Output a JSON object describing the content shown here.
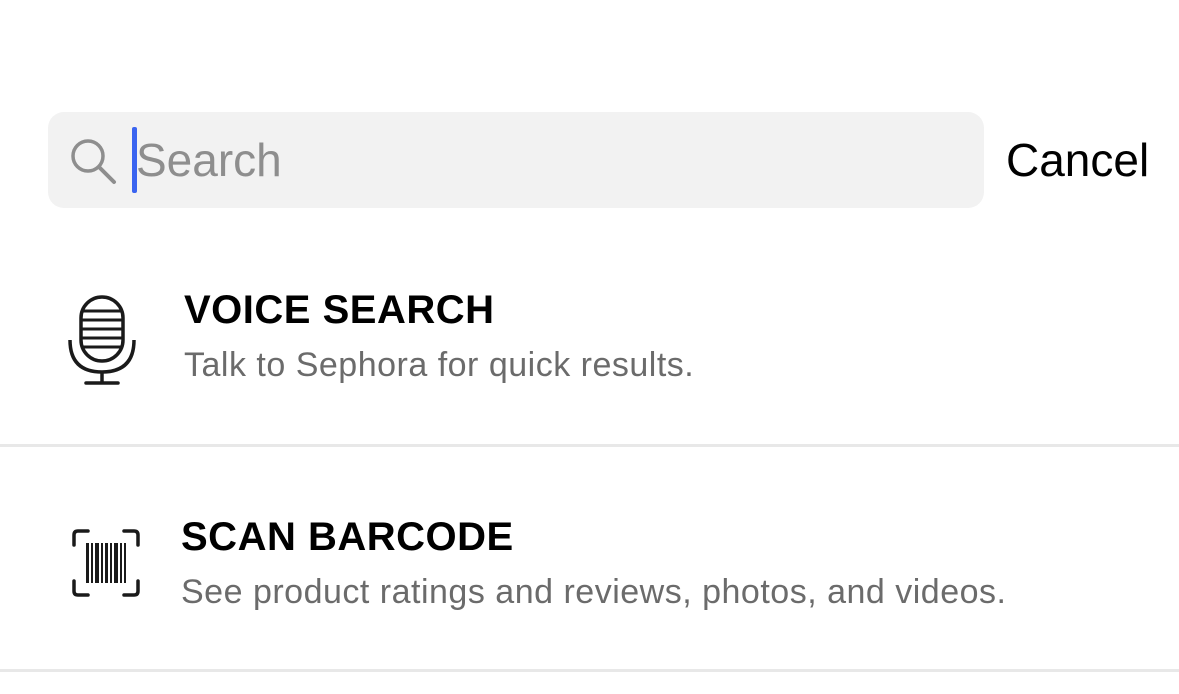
{
  "search": {
    "placeholder": "Search",
    "value": "",
    "cancel_label": "Cancel",
    "icon": "magnifier-icon"
  },
  "options": [
    {
      "title": "VOICE SEARCH",
      "subtitle": "Talk to Sephora for quick results.",
      "icon": "microphone-icon"
    },
    {
      "title": "SCAN BARCODE",
      "subtitle": "See product ratings and reviews, photos, and videos.",
      "icon": "barcode-scan-icon"
    }
  ],
  "colors": {
    "caret": "#3a64f0",
    "search_bg": "#f2f2f2",
    "subtitle": "#6b6b6b",
    "divider": "#e8e8e8"
  }
}
